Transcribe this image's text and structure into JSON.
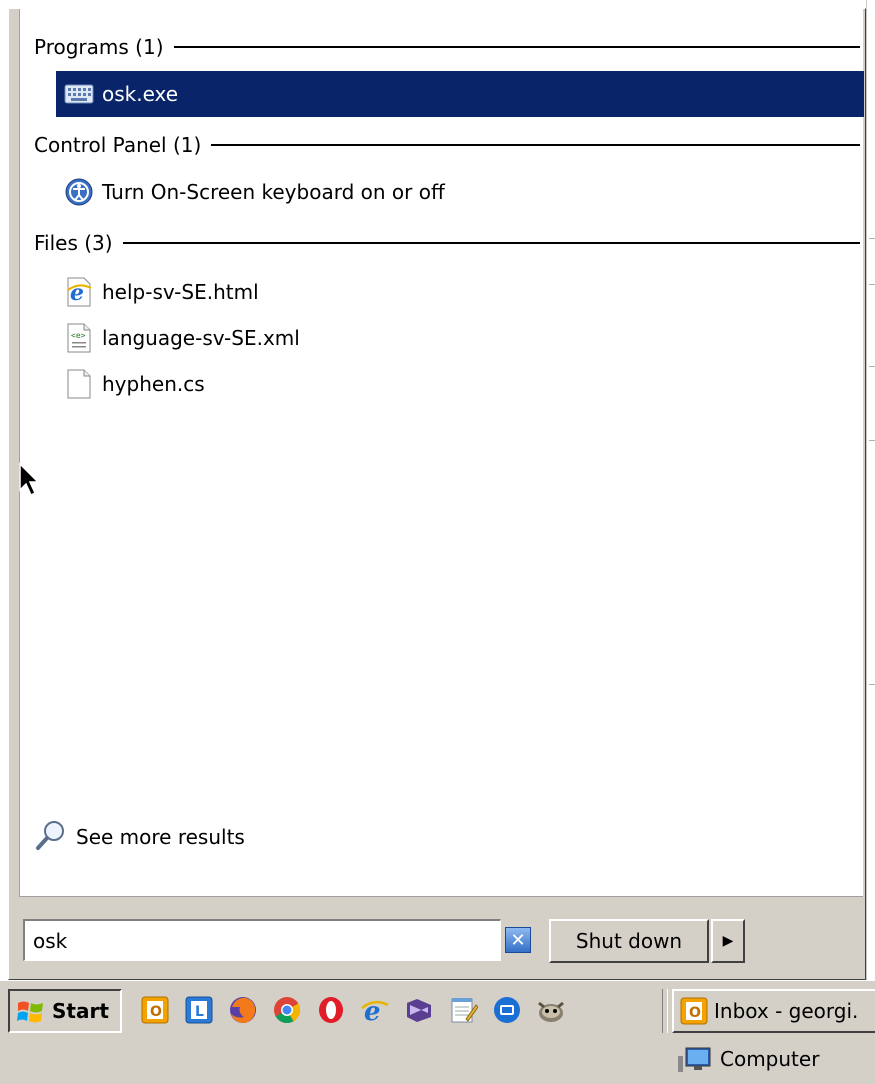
{
  "groups": [
    {
      "label": "Programs (1)",
      "items": [
        {
          "label": "osk.exe",
          "icon": "keyboard-icon",
          "selected": true
        }
      ]
    },
    {
      "label": "Control Panel (1)",
      "items": [
        {
          "label": "Turn On-Screen keyboard on or off",
          "icon": "ease-of-access-icon"
        }
      ]
    },
    {
      "label": "Files (3)",
      "items": [
        {
          "label": "help-sv-SE.html",
          "icon": "internet-explorer-icon"
        },
        {
          "label": "language-sv-SE.xml",
          "icon": "xml-file-icon"
        },
        {
          "label": "hyphen.cs",
          "icon": "blank-file-icon"
        }
      ]
    }
  ],
  "see_more": "See more results",
  "search": {
    "value": "osk"
  },
  "shutdown": {
    "label": "Shut down"
  },
  "taskbar": {
    "start_label": "Start",
    "quicklaunch": [
      "outlook-icon",
      "lync-icon",
      "firefox-icon",
      "chrome-icon",
      "opera-icon",
      "internet-explorer-icon",
      "visual-studio-icon",
      "notepad-icon",
      "teamviewer-icon",
      "gimp-icon"
    ],
    "task_button": "Inbox - georgi.",
    "computer_label": "Computer"
  },
  "colors": {
    "selection": "#0a246a",
    "menu_bg": "#d4d0c8"
  }
}
